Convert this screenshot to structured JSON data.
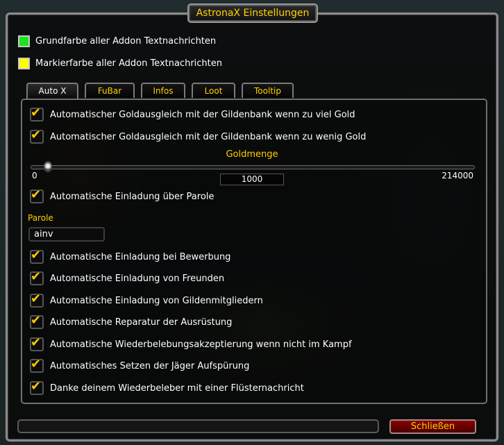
{
  "window": {
    "title": "AstronaX Einstellungen"
  },
  "colors": [
    {
      "label": "Grundfarbe aller Addon Textnachrichten",
      "color": "#19e619"
    },
    {
      "label": "Markierfarbe aller Addon Textnachrichten",
      "color": "#ffff00"
    }
  ],
  "tabs": [
    "Auto X",
    "FuBar",
    "Infos",
    "Loot",
    "Tooltip"
  ],
  "active_tab": "Auto X",
  "options_top": [
    {
      "label": "Automatischer Goldausgleich mit der Gildenbank wenn zu viel Gold",
      "checked": true
    },
    {
      "label": "Automatischer Goldausgleich mit der Gildenbank wenn zu wenig Gold",
      "checked": true
    }
  ],
  "slider": {
    "title": "Goldmenge",
    "min_label": "0",
    "max_label": "214000",
    "value": "1000",
    "min": 0,
    "max": 214000
  },
  "invite_option": {
    "label": "Automatische Einladung über Parole",
    "checked": true
  },
  "parole": {
    "label": "Parole",
    "value": "ainv"
  },
  "options_bottom": [
    {
      "label": "Automatische Einladung bei Bewerbung",
      "checked": true
    },
    {
      "label": "Automatische Einladung von Freunden",
      "checked": true
    },
    {
      "label": "Automatische Einladung von Gildenmitgliedern",
      "checked": true
    },
    {
      "label": "Automatische Reparatur der Ausrüstung",
      "checked": true
    },
    {
      "label": "Automatische Wiederbelebungsakzeptierung wenn nicht im Kampf",
      "checked": true
    },
    {
      "label": "Automatisches Setzen der Jäger Aufspürung",
      "checked": true
    },
    {
      "label": "Danke deinem Wiederbeleber mit einer Flüsternachricht",
      "checked": true
    }
  ],
  "footer": {
    "close_label": "Schließen"
  },
  "accent": "#ffd200"
}
